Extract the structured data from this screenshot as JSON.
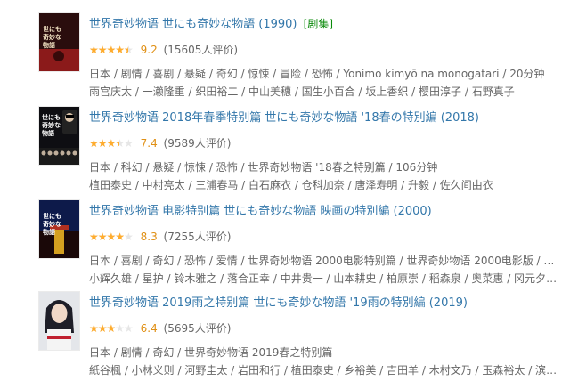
{
  "items": [
    {
      "title": "世界奇妙物语 世にも奇妙な物語 (1990)",
      "tag": "[剧集]",
      "rating": 4.5,
      "score": "9.2",
      "votes": "(15605人评价)",
      "meta": "日本 / 剧情 / 喜剧 / 悬疑 / 奇幻 / 惊悚 / 冒险 / 恐怖 / Yonimo kimyō na monogatari / 20分钟",
      "cast": "雨宫庆太 / 一濑隆重 / 织田裕二 / 中山美穗 / 国生小百合 / 坂上香织 / 樱田淳子 / 石野真子",
      "poster_lines": [
        "世にも",
        "奇妙な",
        "物語"
      ],
      "poster_colors": {
        "bg": "#2a0d0d",
        "accent": "#8b1a1a",
        "text": "#f0e0c0"
      }
    },
    {
      "title": "世界奇妙物语 2018年春季特别篇 世にも奇妙な物語 '18春の特別編 (2018)",
      "tag": "",
      "rating": 3.5,
      "score": "7.4",
      "votes": "(9589人评价)",
      "meta": "日本 / 科幻 / 悬疑 / 惊悚 / 恐怖 / 世界奇妙物语 '18春之特别篇 / 106分钟",
      "cast": "植田泰史 / 中村亮太 / 三浦春马 / 白石麻衣 / 仓科加奈 / 唐泽寿明 / 升毅 / 佐久间由衣",
      "poster_lines": [
        "世にも",
        "奇妙な",
        "物語"
      ],
      "poster_colors": {
        "bg": "#0e0e12",
        "accent": "#b01818",
        "text": "#ffffff"
      }
    },
    {
      "title": "世界奇妙物语 电影特别篇 世にも奇妙な物語 映画の特別編 (2000)",
      "tag": "",
      "rating": 4.0,
      "score": "8.3",
      "votes": "(7255人评价)",
      "meta": "日本 / 喜剧 / 奇幻 / 恐怖 / 爱情 / 世界奇妙物语 2000电影特别篇 / 世界奇妙物语 2000电影版 / 126分钟",
      "cast": "小辉久雄 / 星护 / 铃木雅之 / 落合正幸 / 中井贵一 / 山本耕史 / 柏原崇 / 稻森泉 / 奥菜惠 / 冈元夕纪子 / 武田真治 / ...",
      "poster_lines": [
        "世にも",
        "奇妙な",
        "物語"
      ],
      "poster_colors": {
        "bg": "#0d1a4a",
        "accent": "#d4a020",
        "text": "#ffffff"
      }
    },
    {
      "title": "世界奇妙物语 2019雨之特别篇 世にも奇妙な物語 '19雨の特別編 (2019)",
      "tag": "",
      "rating": 3.0,
      "score": "6.4",
      "votes": "(5695人评价)",
      "meta": "日本 / 剧情 / 奇幻 / 世界奇妙物语 2019春之特别篇",
      "cast": "紙谷楓 / 小林义则 / 河野圭太 / 岩田和行 / 植田泰史 / 乡裕美 / 吉田羊 / 木村文乃 / 玉森裕太 / 滨边美波 / 上白石萌...",
      "poster_lines": [],
      "poster_colors": {
        "bg": "#cfd3da",
        "accent": "#1e1e28",
        "text": "#ffffff"
      }
    }
  ]
}
